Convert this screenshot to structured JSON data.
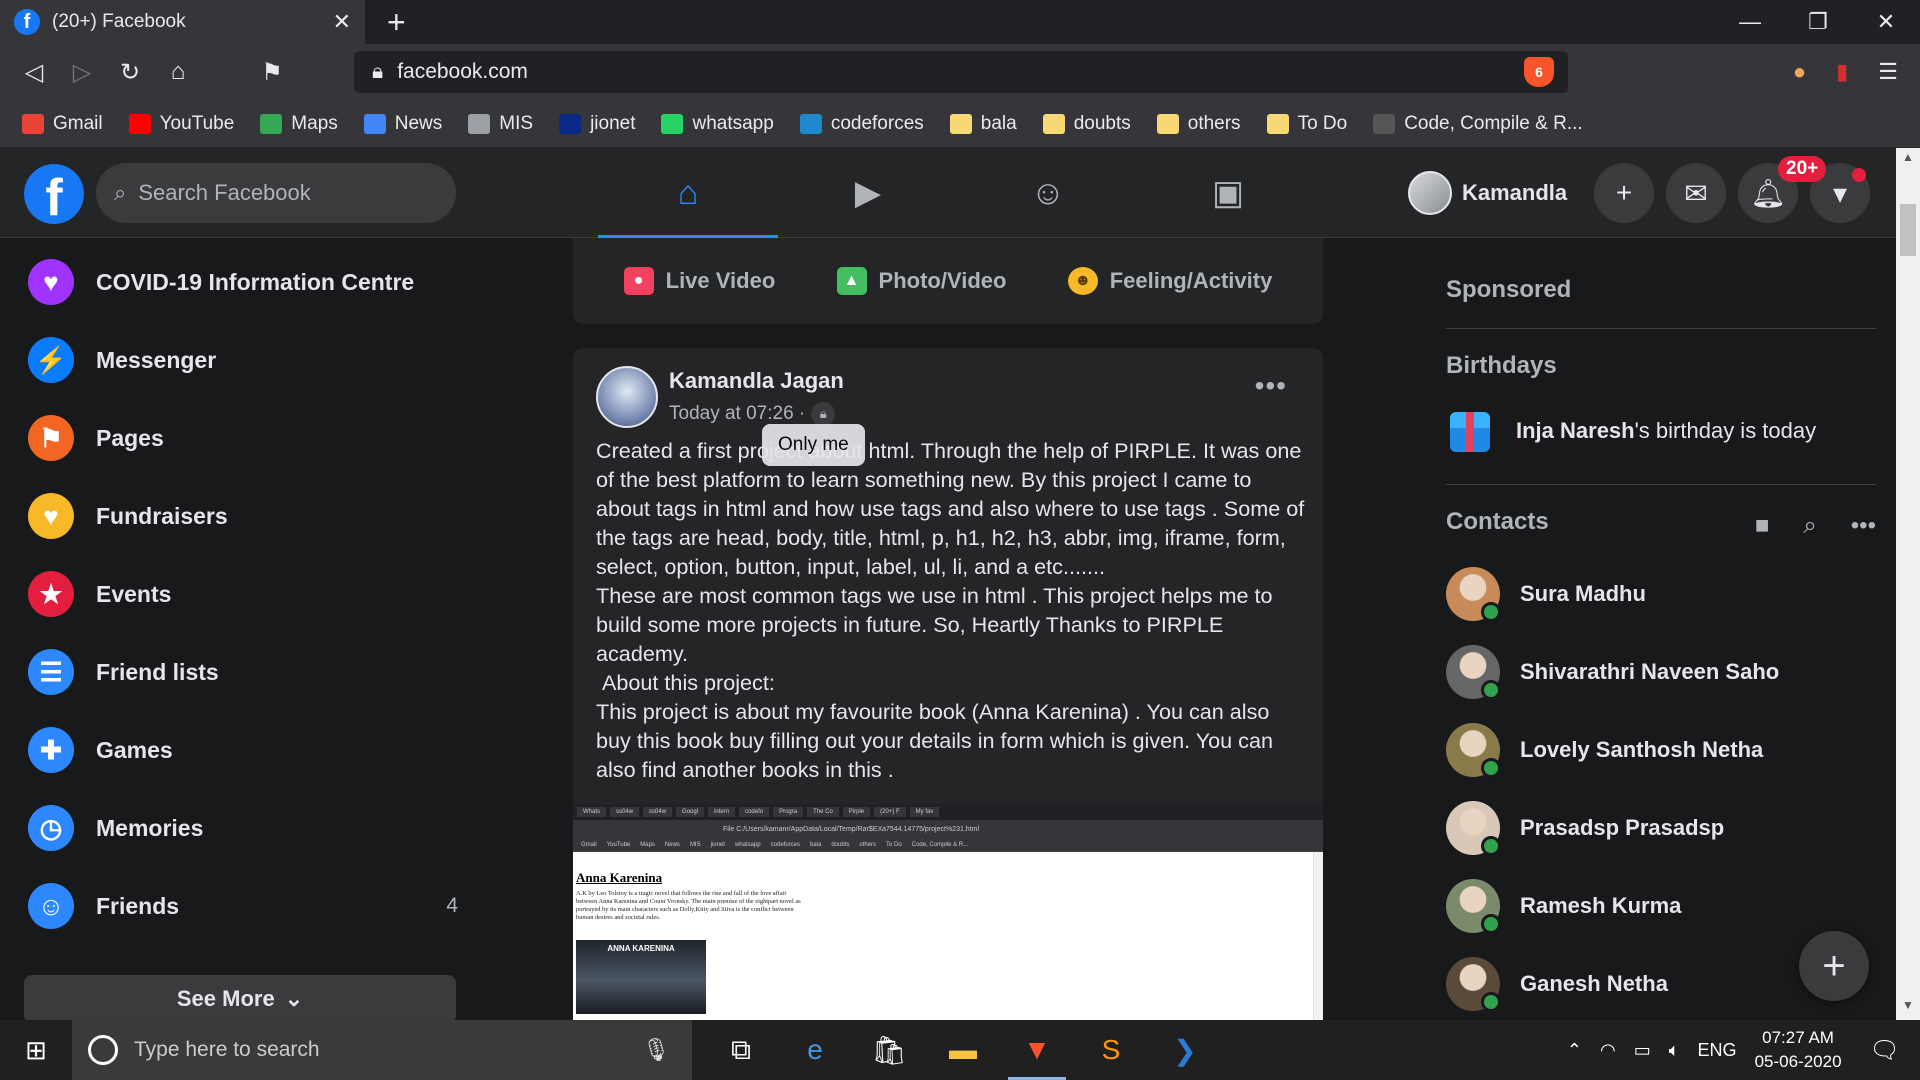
{
  "browser": {
    "tab_title": "(20+) Facebook",
    "url": "facebook.com",
    "shield_count": "6",
    "bookmarks": [
      {
        "label": "Gmail",
        "icon": "gmail-icon",
        "color": "#ea4335"
      },
      {
        "label": "YouTube",
        "icon": "youtube-icon",
        "color": "#ff0000"
      },
      {
        "label": "Maps",
        "icon": "maps-icon",
        "color": "#34a853"
      },
      {
        "label": "News",
        "icon": "news-icon",
        "color": "#4285f4"
      },
      {
        "label": "MIS",
        "icon": "globe-icon",
        "color": "#9aa0a6"
      },
      {
        "label": "jionet",
        "icon": "jio-icon",
        "color": "#0a2885"
      },
      {
        "label": "whatsapp",
        "icon": "whatsapp-icon",
        "color": "#25d366"
      },
      {
        "label": "codeforces",
        "icon": "codeforces-icon",
        "color": "#1f8acb"
      },
      {
        "label": "bala",
        "icon": "folder-icon",
        "color": "#f8d775"
      },
      {
        "label": "doubts",
        "icon": "folder-icon",
        "color": "#f8d775"
      },
      {
        "label": "others",
        "icon": "folder-icon",
        "color": "#f8d775"
      },
      {
        "label": "To Do",
        "icon": "folder-icon",
        "color": "#f8d775"
      },
      {
        "label": "Code, Compile & R...",
        "icon": "cc-icon",
        "color": "#555555"
      }
    ]
  },
  "header": {
    "search_placeholder": "Search Facebook",
    "profile_name": "Kamandla",
    "notif_badge": "20+",
    "accent": "#2d88ff"
  },
  "sidebar": {
    "items": [
      {
        "label": "COVID-19 Information Centre",
        "icon": "covid-shield-icon",
        "count": ""
      },
      {
        "label": "Messenger",
        "icon": "messenger-icon",
        "count": ""
      },
      {
        "label": "Pages",
        "icon": "pages-flag-icon",
        "count": ""
      },
      {
        "label": "Fundraisers",
        "icon": "heart-icon",
        "count": ""
      },
      {
        "label": "Events",
        "icon": "calendar-star-icon",
        "count": ""
      },
      {
        "label": "Friend lists",
        "icon": "friend-list-icon",
        "count": ""
      },
      {
        "label": "Games",
        "icon": "gamepad-icon",
        "count": ""
      },
      {
        "label": "Memories",
        "icon": "clock-icon",
        "count": ""
      },
      {
        "label": "Friends",
        "icon": "friends-icon",
        "count": "4"
      }
    ],
    "see_more": "See More"
  },
  "composer": {
    "live": "Live Video",
    "photo": "Photo/Video",
    "feeling": "Feeling/Activity"
  },
  "post": {
    "author": "Kamandla Jagan",
    "time": "Today at 07:26 ·",
    "tooltip": "Only me",
    "text": "Created a first project about html. Through the help of PIRPLE. It was one of the best platform to learn something new. By this project I came to about tags in html and how use tags and also where to use tags . Some of the tags are head, body, title, html, p, h1, h2, h3, abbr, img, iframe, form, select, option, button, input, label, ul, li, and a etc.......\nThese are most common tags we use in html . This project helps me to build some more projects in future. So, Heartly Thanks to PIRPLE academy.\n About this project:\nThis project is about my favourite book (Anna Karenina) . You can also buy this book buy filling out your details in form which is given. You can also find another books in this .",
    "image": {
      "tabs": [
        "Whats",
        "ss04w",
        "ss04w",
        "Googl",
        "intern",
        "codefo",
        "Progra",
        "The Co",
        "Pirple",
        "(20+) F",
        "My fav"
      ],
      "address": "File  C:/Users/kamanr/AppData/Local/Temp/Rar$EXa7544.14775/project%231.html",
      "bookmarks": [
        "Gmail",
        "YouTube",
        "Maps",
        "News",
        "MIS",
        "jionet",
        "whatsapp",
        "codeforces",
        "bala",
        "doubts",
        "others",
        "To Do",
        "Code, Compile & R..."
      ],
      "page_title": "Anna Karenina",
      "page_text": "A.K by Leo Tolstoy is a tragic novel that follows the rise and fall of the love affair between Anna Karenina and Count Vronsky. The main premise of the eightpart novel as portrayed by its main characters such as Dolly,Kitty and Stiva is the conflict between human desires and societal rules.",
      "poster_label": "ANNA KARENINA"
    }
  },
  "rightcol": {
    "sponsored": "Sponsored",
    "birthdays": "Birthdays",
    "birthday_name": "Inja Naresh",
    "birthday_suffix": "'s birthday is today",
    "contacts_title": "Contacts",
    "contacts": [
      {
        "name": "Sura Madhu"
      },
      {
        "name": "Shivarathri Naveen Saho"
      },
      {
        "name": "Lovely Santhosh Netha"
      },
      {
        "name": "Prasadsp Prasadsp"
      },
      {
        "name": "Ramesh Kurma"
      },
      {
        "name": "Ganesh Netha"
      }
    ]
  },
  "taskbar": {
    "search_placeholder": "Type here to search",
    "lang": "ENG",
    "time": "07:27 AM",
    "date": "05-06-2020"
  }
}
